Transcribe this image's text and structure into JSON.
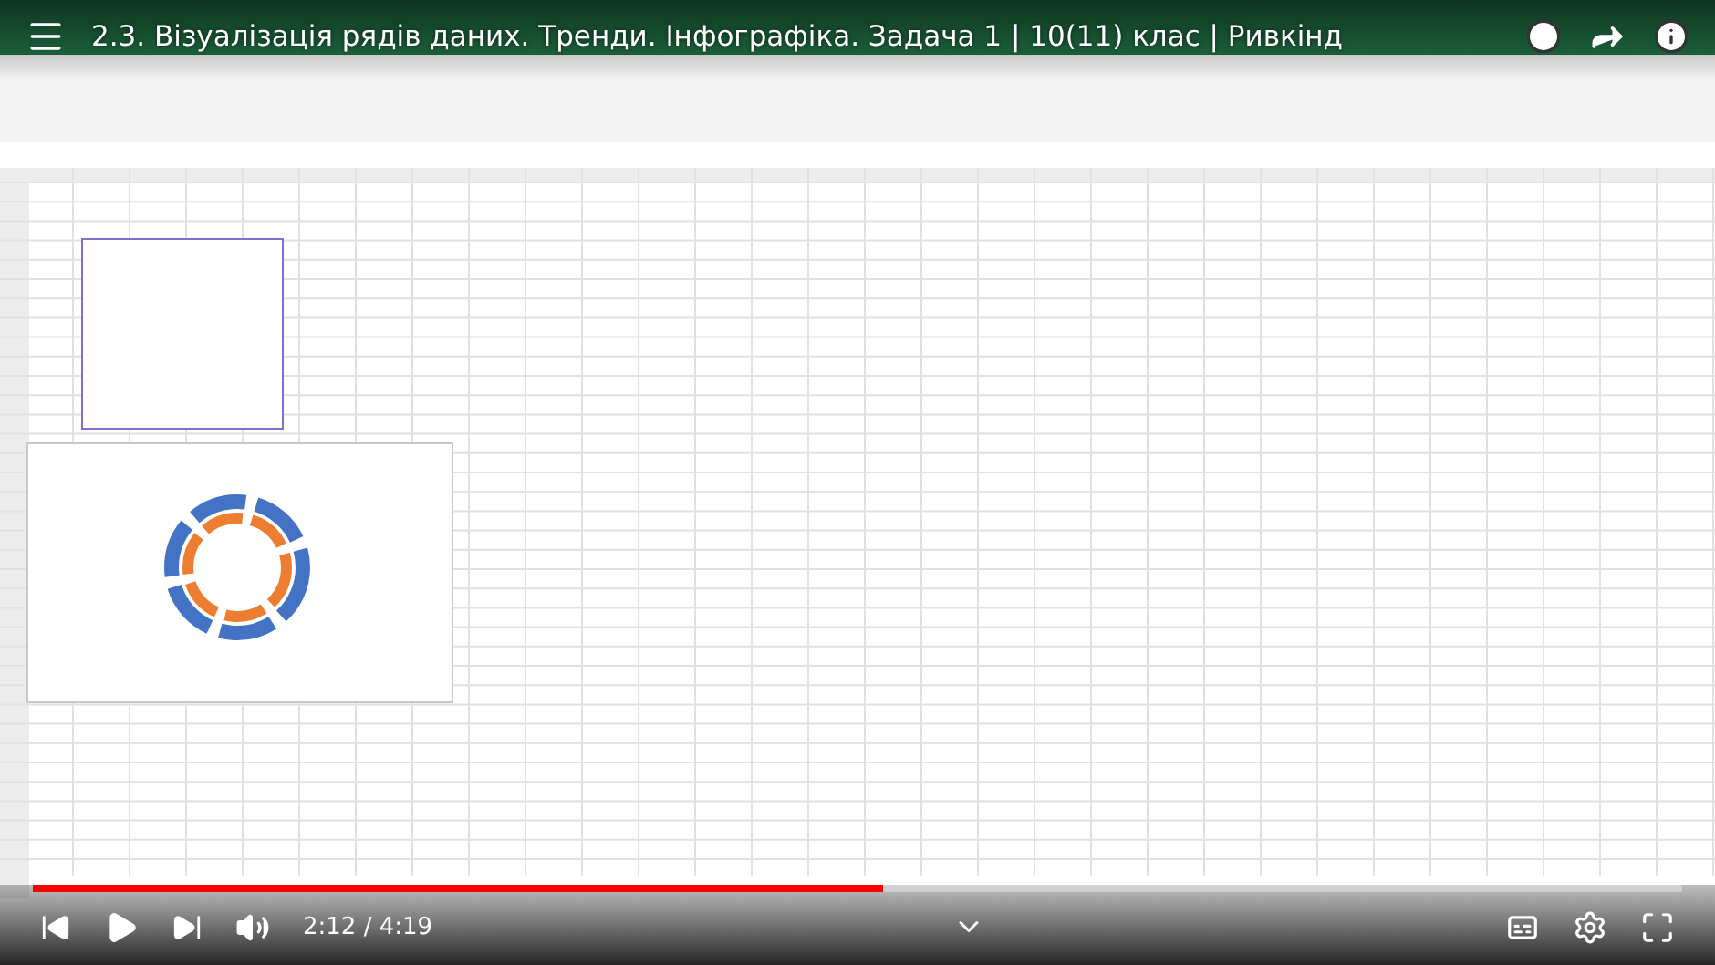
{
  "player": {
    "title": "2.3. Візуалізація рядів даних. Тренди. Інфографіка. Задача 1 | 10(11) клас | Ривкінд",
    "time": "2:12 / 4:19",
    "paused": true,
    "progress": {
      "level": 0.515
    }
  }
}
